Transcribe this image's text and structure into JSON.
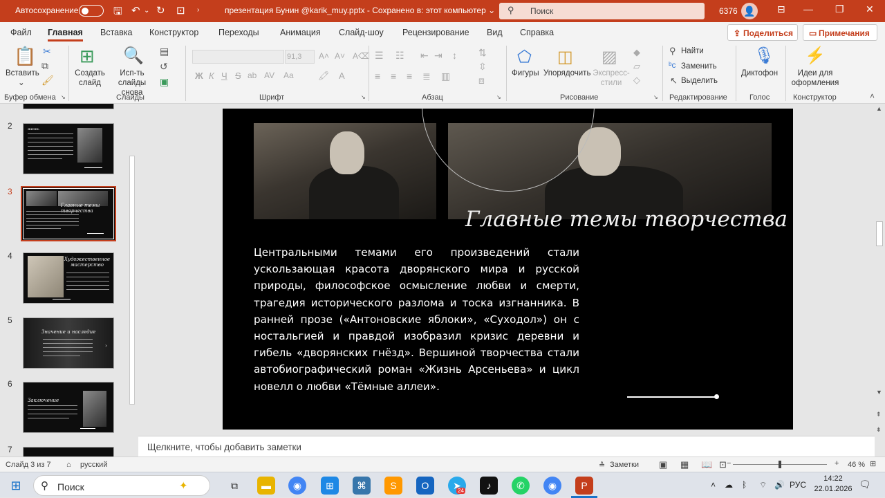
{
  "titlebar": {
    "autosave_label": "Автосохранение",
    "autosave_state": "off",
    "document_title": "презентация Бунин @karik_muy.pptx  -  Сохранено в: этот компьютер ⌄",
    "search_placeholder": "Поиск",
    "user_id": "6376"
  },
  "tabs": [
    "Файл",
    "Главная",
    "Вставка",
    "Конструктор",
    "Переходы",
    "Анимация",
    "Слайд-шоу",
    "Рецензирование",
    "Вид",
    "Справка"
  ],
  "active_tab": "Главная",
  "share_label": "Поделиться",
  "comments_label": "Примечания",
  "ribbon": {
    "paste": "Вставить",
    "clipboard_group": "Буфер обмена",
    "new_slide": "Создать слайд",
    "reuse_slides": "Исп-ть слайды снова",
    "slides_group": "Слайды",
    "font_size": "91,3",
    "font_group": "Шрифт",
    "paragraph_group": "Абзац",
    "shapes": "Фигуры",
    "arrange": "Упорядочить",
    "quick_styles": "Экспресс-стили",
    "drawing_group": "Рисование",
    "find": "Найти",
    "replace": "Заменить",
    "select": "Выделить",
    "editing_group": "Редактирование",
    "dictate": "Диктофон",
    "voice_group": "Голос",
    "design_ideas": "Идеи для оформления",
    "designer_group": "Конструктор",
    "bold": "Ж",
    "italic": "К",
    "underline": "Ч",
    "strike": "S",
    "shadow": "ab"
  },
  "thumbnails": [
    {
      "number": "2",
      "title": "жизнь"
    },
    {
      "number": "3",
      "title": "Главные темы творчества",
      "active": true
    },
    {
      "number": "4",
      "title": "Художественное мастерство"
    },
    {
      "number": "5",
      "title": "Значение и наследие"
    },
    {
      "number": "6",
      "title": "Заключение"
    },
    {
      "number": "7",
      "title": ""
    }
  ],
  "slide": {
    "title": "Главные темы творчества",
    "body": "Центральными темами его произведений стали ускользающая красота дворянского мира и русской природы, философское осмысление любви и смерти, трагедия исторического разлома и тоска изгнанника. В ранней прозе («Антоновские яблоки», «Суходол») он с ностальгией и правдой изобразил кризис деревни и гибель «дворянских гнёзд». Вершиной творчества стали автобиографический роман «Жизнь Арсеньева» и цикл новелл о любви «Тёмные аллеи»."
  },
  "notes_placeholder": "Щелкните, чтобы добавить заметки",
  "status": {
    "slide_counter": "Слайд 3 из 7",
    "language": "русский",
    "notes_button": "Заметки",
    "zoom": "46 %"
  },
  "taskbar": {
    "search_label": "Поиск",
    "language": "РУС",
    "time": "14:22",
    "date": "22.01.2026",
    "telegram_badge": "24"
  },
  "colors": {
    "accent": "#c43e1c",
    "slide_bg": "#000000"
  }
}
